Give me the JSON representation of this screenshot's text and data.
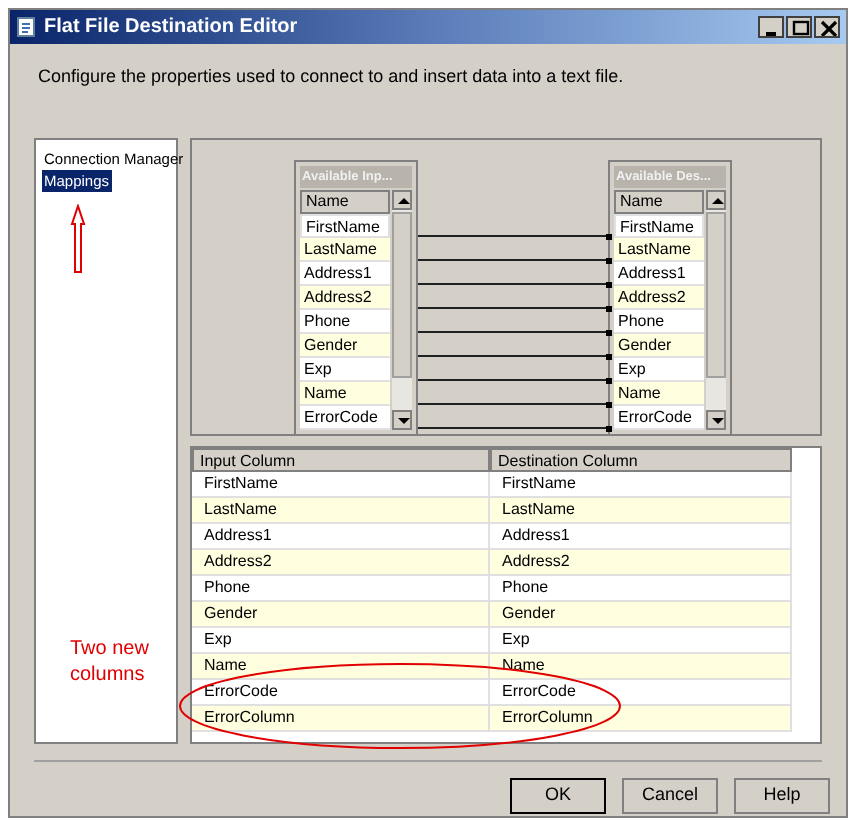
{
  "window": {
    "title": "Flat File Destination Editor"
  },
  "description": "Configure the properties used to connect to and insert data into a text file.",
  "nav": [
    {
      "label": "Connection Manager",
      "selected": false
    },
    {
      "label": "Mappings",
      "selected": true
    }
  ],
  "input_list": {
    "title": "Available Inp...",
    "header": "Name",
    "items": [
      "FirstName",
      "LastName",
      "Address1",
      "Address2",
      "Phone",
      "Gender",
      "Exp",
      "Name",
      "ErrorCode"
    ]
  },
  "destination_list": {
    "title": "Available Des...",
    "header": "Name",
    "items": [
      "FirstName",
      "LastName",
      "Address1",
      "Address2",
      "Phone",
      "Gender",
      "Exp",
      "Name",
      "ErrorCode"
    ]
  },
  "mapping_table": {
    "columns": [
      "Input Column",
      "Destination Column"
    ],
    "rows": [
      [
        "FirstName",
        "FirstName"
      ],
      [
        "LastName",
        "LastName"
      ],
      [
        "Address1",
        "Address1"
      ],
      [
        "Address2",
        "Address2"
      ],
      [
        "Phone",
        "Phone"
      ],
      [
        "Gender",
        "Gender"
      ],
      [
        "Exp",
        "Exp"
      ],
      [
        "Name",
        "Name"
      ],
      [
        "ErrorCode",
        "ErrorCode"
      ],
      [
        "ErrorColumn",
        "ErrorColumn"
      ]
    ]
  },
  "annotation": "Two new columns",
  "buttons": [
    "OK",
    "Cancel",
    "Help"
  ]
}
